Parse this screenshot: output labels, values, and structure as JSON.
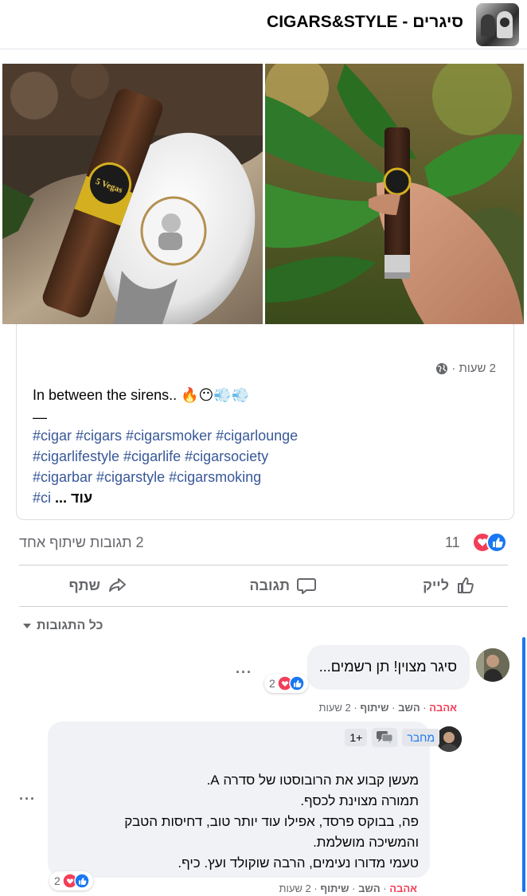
{
  "header": {
    "title": "סיגרים - CIGARS&STYLE"
  },
  "photos": {
    "left_cigar_band": "5 Vegas"
  },
  "post": {
    "meta_time": "2 שעות ·",
    "text": "In between the sirens.. 🔥😶💨💨",
    "dash": "—",
    "hashtag_lines": [
      "#cigar #cigars #cigarsmoker #cigarlounge",
      "#cigarlifestyle #cigarlife #cigarsociety",
      "#cigarbar #cigarstyle #cigarsmoking"
    ],
    "truncated_tag": "#ci",
    "more_label": "... עוד"
  },
  "reactions": {
    "count": "11",
    "stats": "2 תגובות  שיתוף אחד",
    "icons": [
      "like-icon",
      "love-icon"
    ]
  },
  "actions": {
    "like": "לייק",
    "comment": "תגובה",
    "share": "שתף"
  },
  "comments_filter": {
    "label": "כל התגובות"
  },
  "comments": [
    {
      "text": "סיגר מצוין! תן רשמים...",
      "reaction_count": "2",
      "links": {
        "love": "אהבה",
        "reply": "השב",
        "share": "שיתוף",
        "time": "2 שעות"
      }
    },
    {
      "badges": {
        "author": "מחבר",
        "plus": "+1"
      },
      "lines": [
        "מעשן קבוע את הרובוסטו של סדרה A.",
        "תמורה מצוינת לכסף.",
        "פה, בבוקס פרסד, אפילו עוד יותר טוב, דחיסות הטבק",
        "והמשיכה מושלמת.",
        "טעמי מדורו נעימים, הרבה שוקולד ועץ. כיף."
      ],
      "reaction_count": "2",
      "links": {
        "love": "אהבה",
        "reply": "השב",
        "share": "שיתוף",
        "time": "2 שעות"
      }
    }
  ],
  "colors": {
    "link": "#385898",
    "brand": "#1877f2",
    "love": "#f33e58",
    "muted": "#65676b"
  }
}
